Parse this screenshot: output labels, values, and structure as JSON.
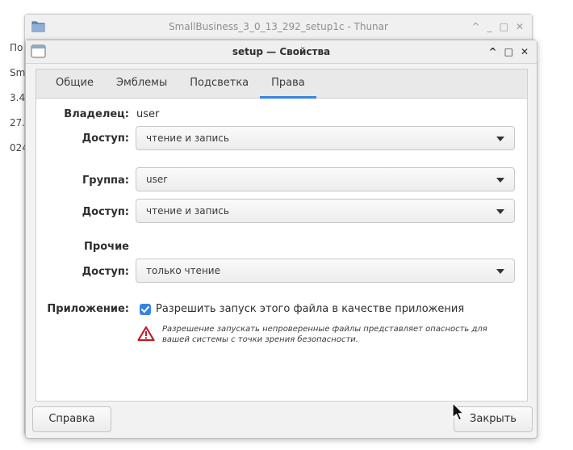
{
  "background_window": {
    "title": "SmallBusiness_3_0_13_292_setup1c - Thunar",
    "controls": [
      "^",
      "_",
      "□",
      "✕"
    ],
    "left_fragments": [
      "По",
      "Sm",
      "3.4",
      "27.",
      "024"
    ]
  },
  "dialog": {
    "title": "setup — Свойства",
    "controls": [
      "^",
      "□",
      "✕"
    ],
    "tabs": [
      {
        "label": "Общие",
        "active": false
      },
      {
        "label": "Эмблемы",
        "active": false
      },
      {
        "label": "Подсветка",
        "active": false
      },
      {
        "label": "Права",
        "active": true
      }
    ],
    "permissions": {
      "owner_label": "Владелец:",
      "owner_value": "user",
      "owner_access_label": "Доступ:",
      "owner_access_value": "чтение и запись",
      "group_label": "Группа:",
      "group_value": "user",
      "group_access_label": "Доступ:",
      "group_access_value": "чтение и запись",
      "others_label": "Прочие",
      "others_access_label": "Доступ:",
      "others_access_value": "только чтение",
      "program_label": "Приложение:",
      "program_checkbox_label": "Разрешить запуск этого файла в качестве приложения",
      "program_checked": true,
      "warning_line1": "Разрешение запускать непроверенные файлы представляет опасность для",
      "warning_line2": "вашей системы с точки зрения безопасности."
    },
    "buttons": {
      "help": "Справка",
      "close": "Закрыть"
    }
  },
  "colors": {
    "accent": "#3584e4",
    "warning_red": "#c01c28"
  },
  "icons": [
    "folder-icon",
    "window-icon",
    "warning-icon",
    "checkmark-icon",
    "mouse-cursor-icon"
  ]
}
